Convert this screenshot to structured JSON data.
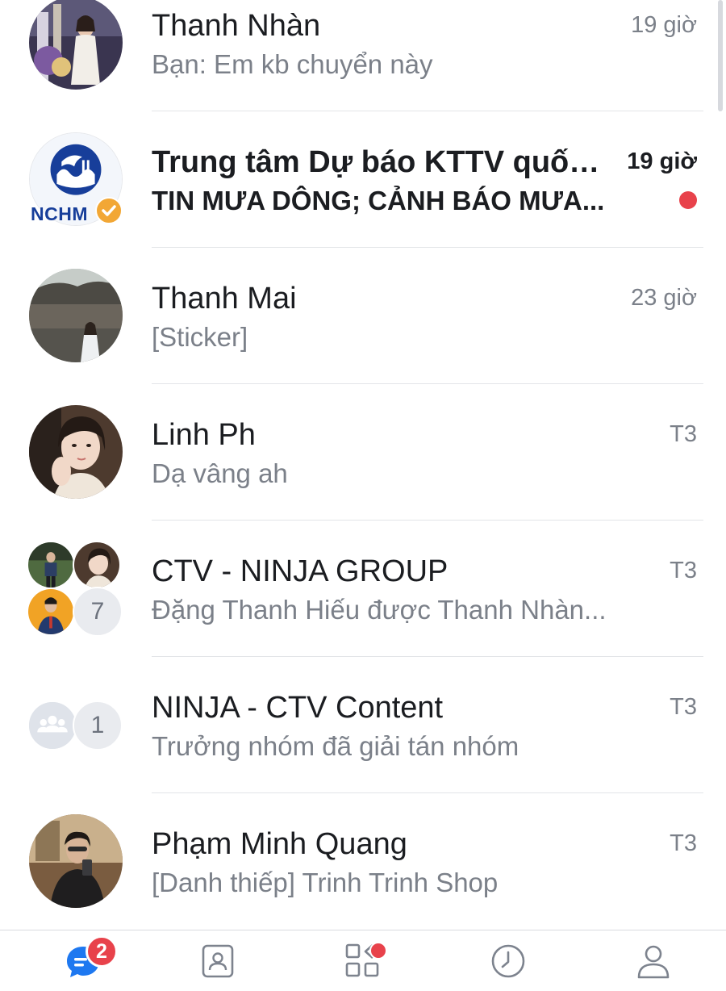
{
  "conversations": [
    {
      "name": "Thanh Nhàn",
      "preview": "Bạn: Em kb chuyển này",
      "time": "19 giờ",
      "unread": false
    },
    {
      "name": "Trung tâm Dự báo KTTV quốc...",
      "preview": "TIN MƯA DÔNG; CẢNH BÁO MƯA...",
      "time": "19 giờ",
      "unread": true,
      "avatar_text": "NCHM",
      "verified": true
    },
    {
      "name": "Thanh Mai",
      "preview": "[Sticker]",
      "time": "23 giờ",
      "unread": false
    },
    {
      "name": "Linh Ph",
      "preview": "Dạ vâng ah",
      "time": "T3",
      "unread": false
    },
    {
      "name": "CTV - NINJA GROUP",
      "preview": "Đặng Thanh Hiếu được Thanh Nhàn...",
      "time": "T3",
      "unread": false,
      "group_extra_count": "7"
    },
    {
      "name": "NINJA - CTV Content",
      "preview": "Trưởng nhóm đã giải tán nhóm",
      "time": "T3",
      "unread": false,
      "group_extra_count": "1"
    },
    {
      "name": "Phạm Minh Quang",
      "preview": "[Danh thiếp] Trinh Trinh Shop",
      "time": "T3",
      "unread": false
    }
  ],
  "tabbar": {
    "messages_badge": "2",
    "tabs": [
      {
        "icon": "chat-bubble-icon",
        "active": true
      },
      {
        "icon": "contacts-icon",
        "active": false
      },
      {
        "icon": "discover-grid-icon",
        "active": false,
        "dot": true
      },
      {
        "icon": "clock-icon",
        "active": false
      },
      {
        "icon": "profile-icon",
        "active": false
      }
    ]
  },
  "colors": {
    "accent": "#1e78f0",
    "unread_red": "#e8424b",
    "text_primary": "#1b1d21",
    "text_secondary": "#7b8089",
    "icon_gray": "#7d838e"
  }
}
